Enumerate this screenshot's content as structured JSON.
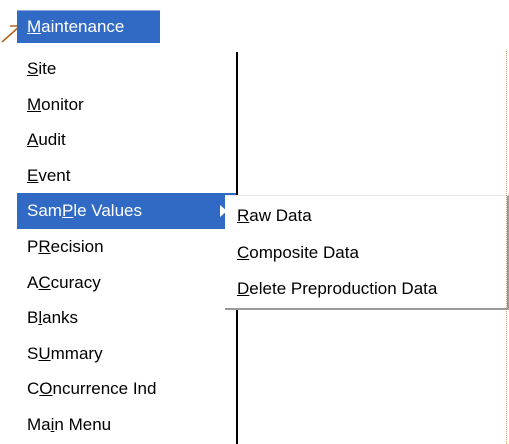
{
  "menu": {
    "title": "Maintenance",
    "title_underline": "M",
    "title_rest": "aintenance",
    "items": [
      {
        "pre": "",
        "u": "S",
        "post": "ite",
        "selected": false,
        "submenu": false
      },
      {
        "pre": "",
        "u": "M",
        "post": "onitor",
        "selected": false,
        "submenu": false
      },
      {
        "pre": "",
        "u": "A",
        "post": "udit",
        "selected": false,
        "submenu": false
      },
      {
        "pre": "",
        "u": "E",
        "post": "vent",
        "selected": false,
        "submenu": false
      },
      {
        "pre": "Sam",
        "u": "P",
        "post": "le Values",
        "selected": true,
        "submenu": true
      },
      {
        "pre": "P",
        "u": "R",
        "post": "ecision",
        "selected": false,
        "submenu": false
      },
      {
        "pre": "A",
        "u": "C",
        "post": "curacy",
        "selected": false,
        "submenu": false
      },
      {
        "pre": "B",
        "u": "l",
        "post": "anks",
        "selected": false,
        "submenu": false
      },
      {
        "pre": "S",
        "u": "U",
        "post": "mmary",
        "selected": false,
        "submenu": false
      },
      {
        "pre": "C",
        "u": "O",
        "post": "ncurrence Ind",
        "selected": false,
        "submenu": false
      },
      {
        "pre": "Ma",
        "u": "i",
        "post": "n Menu",
        "selected": false,
        "submenu": false
      }
    ]
  },
  "submenu": {
    "items": [
      {
        "pre": "",
        "u": "R",
        "post": "aw Data"
      },
      {
        "pre": "",
        "u": "C",
        "post": "omposite Data"
      },
      {
        "pre": "",
        "u": "D",
        "post": "elete Preproduction Data"
      }
    ]
  },
  "colors": {
    "selection_bg": "#316ac5",
    "selection_fg": "#ffffff",
    "pointer": "#b5651d"
  },
  "icons": {
    "pointer": "arrow-pointer-icon",
    "submenu_indicator": "triangle-right-icon"
  }
}
